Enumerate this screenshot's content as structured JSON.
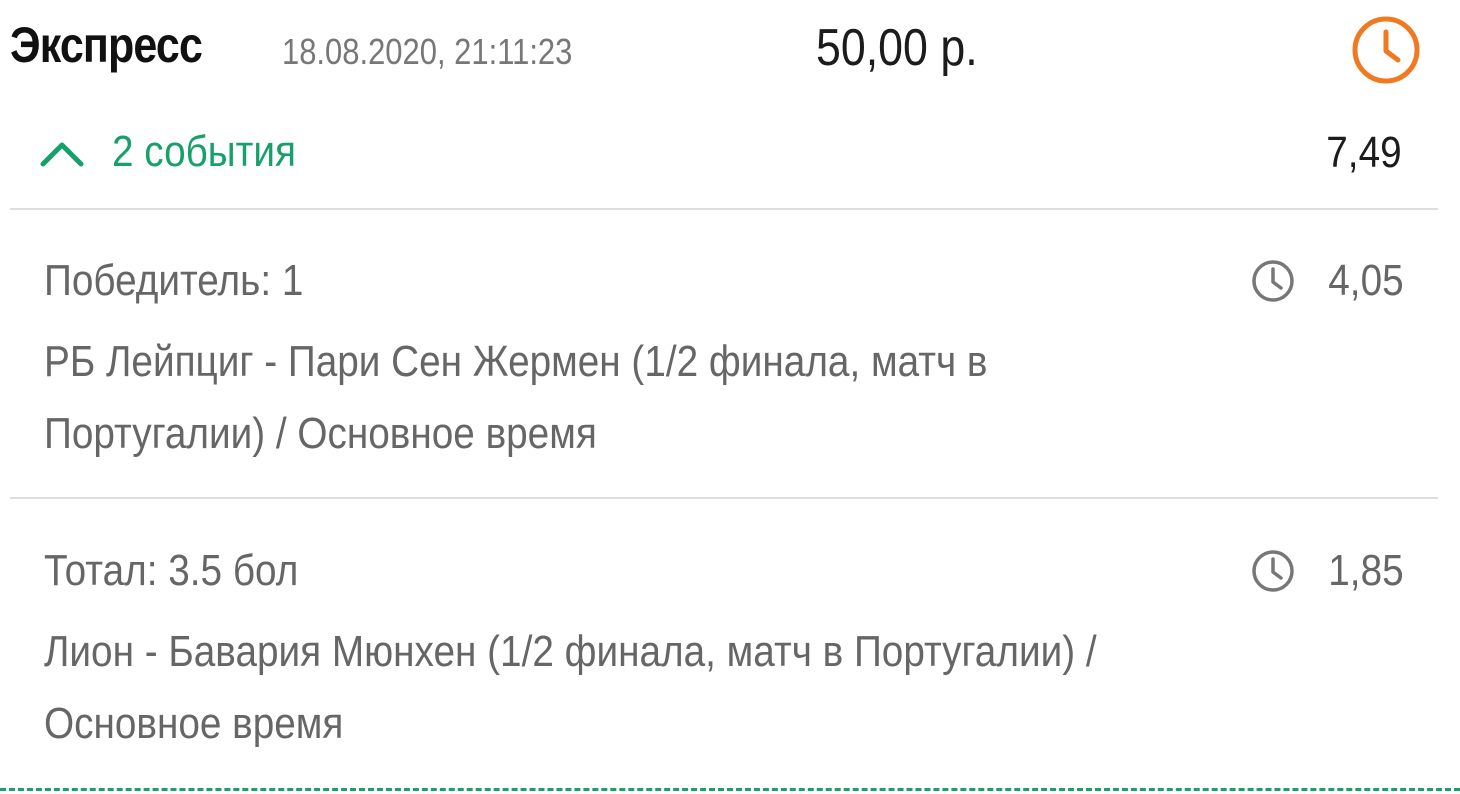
{
  "bet": {
    "type": "Экспресс",
    "date": "18.08.2020, 21:11:23",
    "amount": "50,00 р.",
    "status_icon": "clock-icon",
    "status_color": "#f07a22"
  },
  "events_toggle": {
    "label": "2 события",
    "icon": "chevron-up-icon",
    "color": "#17a06a"
  },
  "total_odds": "7,49",
  "events": [
    {
      "market": "Победитель: 1",
      "match": "РБ Лейпциг - Пари Сен Жермен (1/2 финала, матч в Португалии) / Основное время",
      "odds": "4,05",
      "icon": "clock-icon"
    },
    {
      "market": "Тотал: 3.5 бол",
      "match": "Лион - Бавария Мюнхен (1/2 финала, матч в Португалии) / Основное время",
      "odds": "1,85",
      "icon": "clock-icon"
    }
  ],
  "colors": {
    "accent_green": "#17a06a",
    "pending_orange": "#f07a22",
    "muted_text": "#666666",
    "divider": "#dedede"
  }
}
